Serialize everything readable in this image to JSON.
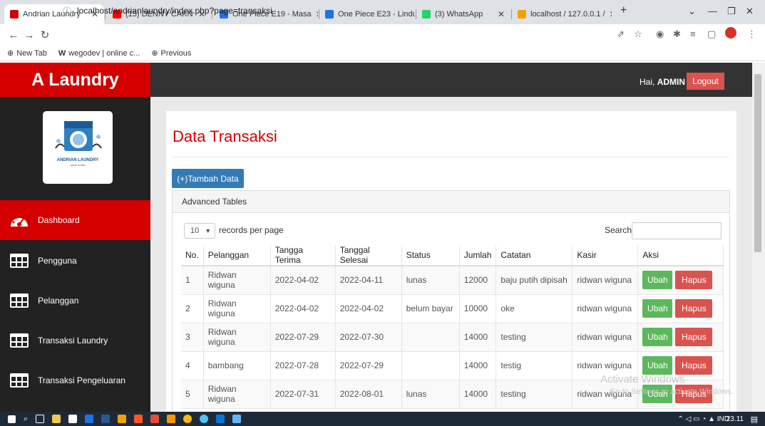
{
  "browser": {
    "tabs": [
      {
        "label": "Andrian Laundry",
        "active": true,
        "color": "#d40000"
      },
      {
        "label": "(15) DENNY CAKN",
        "active": false,
        "color": "#ff0000"
      },
      {
        "label": "One Piece E19 - Masa",
        "active": false,
        "color": "#1a73e8"
      },
      {
        "label": "One Piece E23 - Lindu",
        "active": false,
        "color": "#1a73e8"
      },
      {
        "label": "(3) WhatsApp",
        "active": false,
        "color": "#25d366"
      },
      {
        "label": "localhost / 127.0.0.1 /",
        "active": false,
        "color": "#f4a100"
      }
    ],
    "url": "localhost/andrianlaundry/index.php?page=transaksi",
    "bookmarks": [
      {
        "label": "New Tab",
        "icon": "globe-icon"
      },
      {
        "label": "wegodev | online c...",
        "icon": "w-logo-icon"
      },
      {
        "label": "Previous",
        "icon": "globe-icon"
      }
    ]
  },
  "app": {
    "brand": "A Laundry",
    "greeting_prefix": "Hai, ",
    "user": "ADMIN",
    "logout": "Logout",
    "accent": "#d40000"
  },
  "sidebar": {
    "logo_text": "ANDRIAN LAUNDRY",
    "logo_sub": "clean & fast",
    "items": [
      {
        "label": "Dashboard",
        "icon": "dashboard-gauge-icon",
        "active": true
      },
      {
        "label": "Pengguna",
        "icon": "table-icon",
        "active": false
      },
      {
        "label": "Pelanggan",
        "icon": "table-icon",
        "active": false
      },
      {
        "label": "Transaksi Laundry",
        "icon": "table-icon",
        "active": false
      },
      {
        "label": "Transaksi Pengeluaran",
        "icon": "table-icon",
        "active": false
      }
    ]
  },
  "main": {
    "title": "Data Transaksi",
    "add_button": "(+)Tambah Data",
    "panel_title": "Advanced Tables",
    "page_length": "10",
    "length_label": "records per page",
    "search_label": "Search:",
    "search_value": "",
    "columns": [
      "No.",
      "Pelanggan",
      "Tangga Terima",
      "Tanggal Selesai",
      "Status",
      "Jumlah",
      "Catatan",
      "Kasir",
      "Aksi"
    ],
    "rows": [
      {
        "no": "1",
        "pelanggan": "Ridwan wiguna",
        "terima": "2022-04-02",
        "selesai": "2022-04-11",
        "status": "lunas",
        "jumlah": "12000",
        "catatan": "baju putih dipisah",
        "kasir": "ridwan wiguna"
      },
      {
        "no": "2",
        "pelanggan": "Ridwan wiguna",
        "terima": "2022-04-02",
        "selesai": "2022-04-02",
        "status": "belum bayar",
        "jumlah": "10000",
        "catatan": "oke",
        "kasir": "ridwan wiguna"
      },
      {
        "no": "3",
        "pelanggan": "Ridwan wiguna",
        "terima": "2022-07-29",
        "selesai": "2022-07-30",
        "status": "",
        "jumlah": "14000",
        "catatan": "testing",
        "kasir": "ridwan wiguna"
      },
      {
        "no": "4",
        "pelanggan": "bambang",
        "terima": "2022-07-28",
        "selesai": "2022-07-29",
        "status": "",
        "jumlah": "14000",
        "catatan": "testig",
        "kasir": "ridwan wiguna"
      },
      {
        "no": "5",
        "pelanggan": "Ridwan wiguna",
        "terima": "2022-07-31",
        "selesai": "2022-08-01",
        "status": "lunas",
        "jumlah": "14000",
        "catatan": "testing",
        "kasir": "ridwan wiguna"
      }
    ],
    "ubah": "Ubah",
    "hapus": "Hapus"
  },
  "os": {
    "watermark": "Activate Windows",
    "watermark_sub": "Go to Settings to activate Windows.",
    "lang": "IND",
    "time": "23.11"
  }
}
